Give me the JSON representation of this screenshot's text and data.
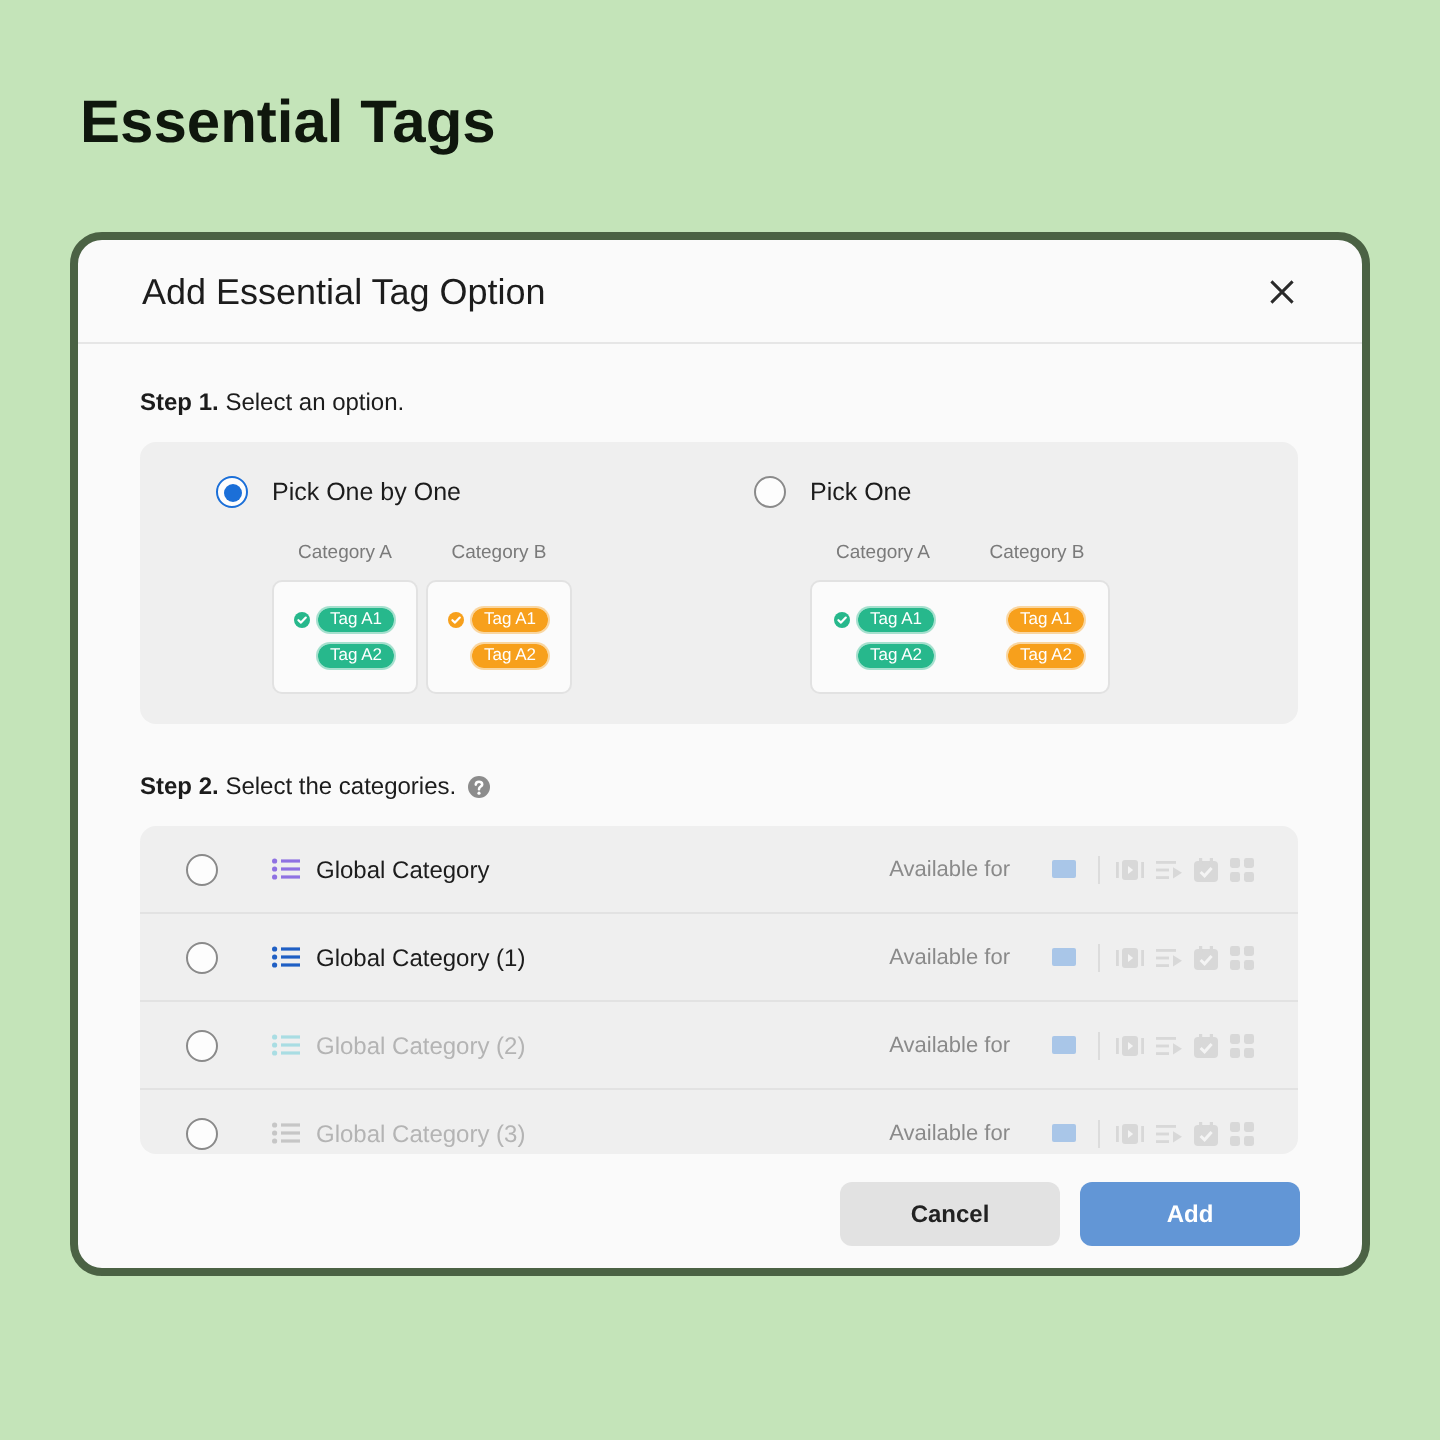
{
  "page_title": "Essential Tags",
  "dialog": {
    "title": "Add Essential Tag Option",
    "step1": {
      "number": "Step 1.",
      "text": "Select an option.",
      "options": [
        {
          "label": "Pick One by One",
          "selected": true,
          "kind": "separate",
          "categories": [
            {
              "name": "Category A",
              "color": "#27b88c",
              "tags": [
                {
                  "label": "Tag A1",
                  "checked": true
                },
                {
                  "label": "Tag A2",
                  "checked": false
                }
              ]
            },
            {
              "name": "Category B",
              "color": "#f7a01c",
              "tags": [
                {
                  "label": "Tag A1",
                  "checked": true
                },
                {
                  "label": "Tag A2",
                  "checked": false
                }
              ]
            }
          ]
        },
        {
          "label": "Pick One",
          "selected": false,
          "kind": "combined",
          "categories": [
            {
              "name": "Category A",
              "color": "#27b88c",
              "tags": [
                {
                  "label": "Tag A1",
                  "checked": true
                },
                {
                  "label": "Tag A2",
                  "checked": false
                }
              ]
            },
            {
              "name": "Category B",
              "color": "#f7a01c",
              "tags": [
                {
                  "label": "Tag A1",
                  "checked": false
                },
                {
                  "label": "Tag A2",
                  "checked": false
                }
              ]
            }
          ]
        }
      ]
    },
    "step2": {
      "number": "Step 2.",
      "text": "Select the categories.",
      "categories": [
        {
          "name": "Global Category",
          "selected": false,
          "disabled": false,
          "color": "#8f72e2",
          "availability": "Available for"
        },
        {
          "name": "Global Category (1)",
          "selected": false,
          "disabled": false,
          "color": "#1f5fc4",
          "availability": "Available for"
        },
        {
          "name": "Global Category (2)",
          "selected": false,
          "disabled": true,
          "color": "#a9dde3",
          "availability": "Available for"
        },
        {
          "name": "Global Category (3)",
          "selected": false,
          "disabled": true,
          "color": "#c6c6c6",
          "availability": "Available for"
        }
      ]
    },
    "buttons": [
      {
        "label": "Cancel",
        "kind": "secondary",
        "disabled": false
      },
      {
        "label": "Add",
        "kind": "primary",
        "disabled": true
      }
    ]
  }
}
